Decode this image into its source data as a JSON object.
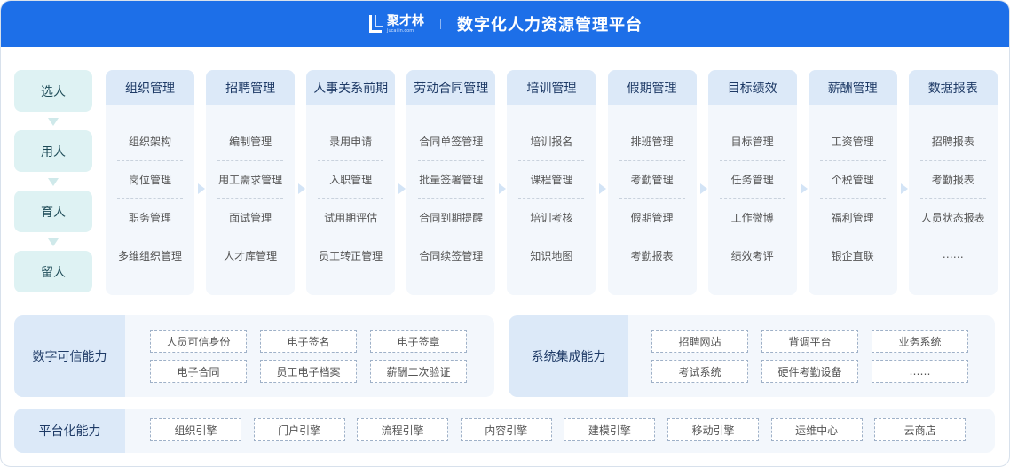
{
  "header": {
    "logo_name": "聚才林",
    "logo_sub": "Jucailin.com",
    "title": "数字化人力资源管理平台"
  },
  "stages": [
    "选人",
    "用人",
    "育人",
    "留人"
  ],
  "modules": [
    {
      "title": "组织管理",
      "items": [
        "组织架构",
        "岗位管理",
        "职务管理",
        "多维组织管理"
      ]
    },
    {
      "title": "招聘管理",
      "items": [
        "编制管理",
        "用工需求管理",
        "面试管理",
        "人才库管理"
      ]
    },
    {
      "title": "人事关系前期",
      "items": [
        "录用申请",
        "入职管理",
        "试用期评估",
        "员工转正管理"
      ]
    },
    {
      "title": "劳动合同管理",
      "items": [
        "合同单签管理",
        "批量签署管理",
        "合同到期提醒",
        "合同续签管理"
      ]
    },
    {
      "title": "培训管理",
      "items": [
        "培训报名",
        "课程管理",
        "培训考核",
        "知识地图"
      ]
    },
    {
      "title": "假期管理",
      "items": [
        "排班管理",
        "考勤管理",
        "假期管理",
        "考勤报表"
      ]
    },
    {
      "title": "目标绩效",
      "items": [
        "目标管理",
        "任务管理",
        "工作微博",
        "绩效考评"
      ]
    },
    {
      "title": "薪酬管理",
      "items": [
        "工资管理",
        "个税管理",
        "福利管理",
        "银企直联"
      ]
    },
    {
      "title": "数据报表",
      "items": [
        "招聘报表",
        "考勤报表",
        "人员状态报表",
        "……"
      ]
    }
  ],
  "trust": {
    "label": "数字可信能力",
    "tags": [
      "人员可信身份",
      "电子签名",
      "电子签章",
      "电子合同",
      "员工电子档案",
      "薪酬二次验证"
    ]
  },
  "integration": {
    "label": "系统集成能力",
    "tags": [
      "招聘网站",
      "背调平台",
      "业务系统",
      "考试系统",
      "硬件考勤设备",
      "……"
    ]
  },
  "platform": {
    "label": "平台化能力",
    "tags": [
      "组织引擎",
      "门户引擎",
      "流程引擎",
      "内容引擎",
      "建模引擎",
      "移动引擎",
      "运维中心",
      "云商店"
    ]
  }
}
